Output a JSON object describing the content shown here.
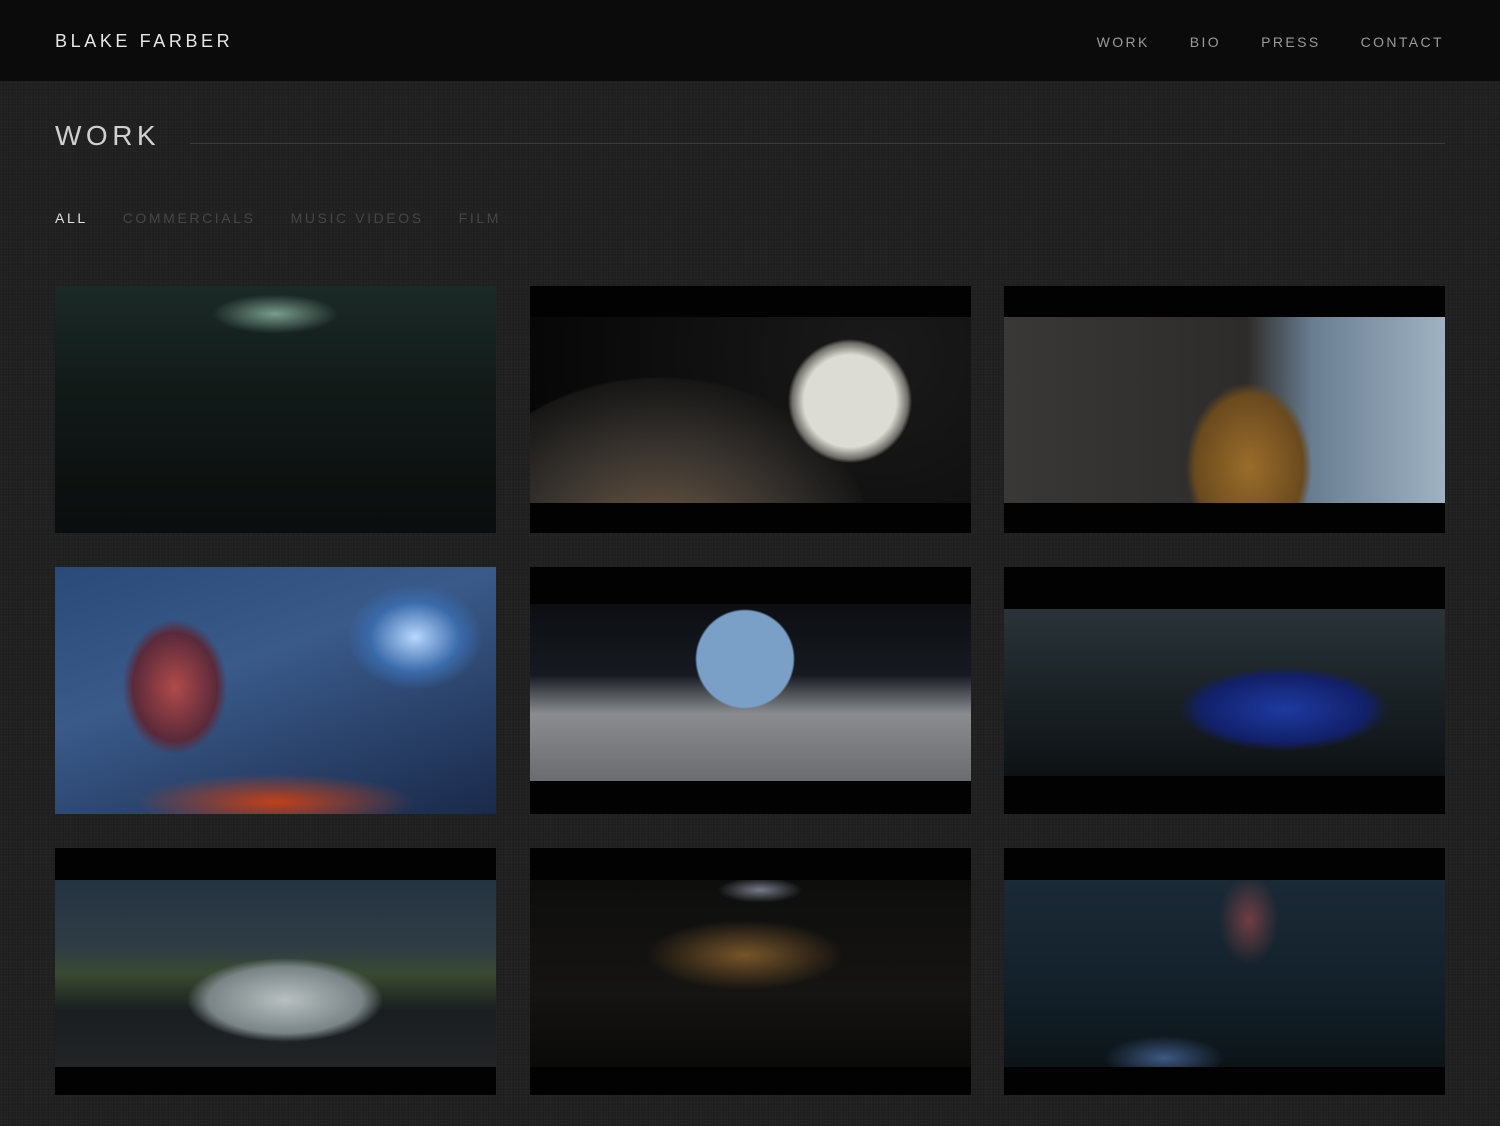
{
  "header": {
    "brand": "BLAKE FARBER",
    "nav": [
      "WORK",
      "BIO",
      "PRESS",
      "CONTACT"
    ]
  },
  "section": {
    "title": "WORK"
  },
  "filters": {
    "items": [
      "ALL",
      "COMMERCIALS",
      "MUSIC VIDEOS",
      "FILM"
    ],
    "active": "ALL"
  },
  "colors": {
    "page_background": "#202020",
    "header_background": "#0b0b0b",
    "active_filter": "#e2e2e2",
    "inactive_filter": "#464646",
    "nav_text": "#9a9a9a"
  },
  "icons": {
    "thumbnails": [
      "video-thumbnail",
      "video-thumbnail",
      "video-thumbnail",
      "video-thumbnail",
      "video-thumbnail",
      "video-thumbnail",
      "video-thumbnail",
      "video-thumbnail",
      "video-thumbnail"
    ]
  }
}
